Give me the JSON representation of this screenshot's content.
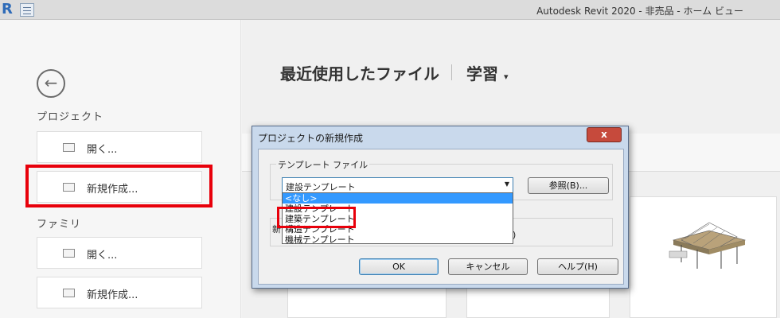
{
  "window": {
    "title": "Autodesk Revit 2020 - 非売品 - ホーム ビュー",
    "logo_letter": "R"
  },
  "sidebar": {
    "back_arrow": "←",
    "project_label": "プロジェクト",
    "project_open": "開く...",
    "project_new": "新規作成...",
    "family_label": "ファミリ",
    "family_open": "開く...",
    "family_new": "新規作成..."
  },
  "main": {
    "recent_files": "最近使用したファイル",
    "learn": "学習",
    "learn_caret": "▾"
  },
  "dialog": {
    "title": "プロジェクトの新規作成",
    "close": "x",
    "template_group_label": "テンプレート ファイル",
    "selected_template": "建設テンプレート",
    "combo_arrow": "▼",
    "browse_button": "参照(B)...",
    "dropdown_items": [
      "<なし>",
      "建設テンプレート",
      "建築テンプレート",
      "構造テンプレート",
      "機械テンプレート"
    ],
    "hidden_label": "新",
    "hidden_suffix": ")",
    "ok": "OK",
    "cancel": "キャンセル",
    "help": "ヘルプ(H)"
  },
  "colors": {
    "highlight": "#e8000b",
    "selection": "#3399ff"
  }
}
